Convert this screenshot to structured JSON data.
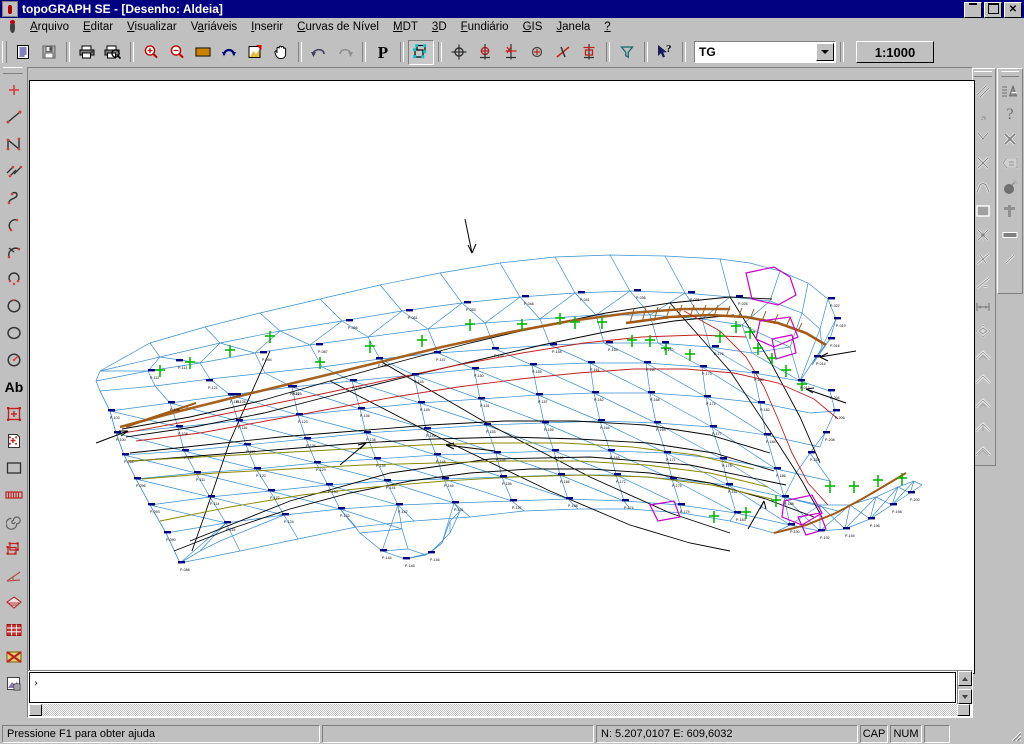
{
  "window": {
    "title": "topoGRAPH SE - [Desenho: Aldeia]",
    "minimize_label": "_",
    "maximize_label": "□",
    "close_label": "✕",
    "app_icon": "topograph-app-icon"
  },
  "menu": {
    "system_icon": "document-pin-icon",
    "items": [
      {
        "label": "Arquivo",
        "accel": "A"
      },
      {
        "label": "Editar",
        "accel": "E"
      },
      {
        "label": "Visualizar",
        "accel": "V"
      },
      {
        "label": "Variáveis",
        "accel": "a"
      },
      {
        "label": "Inserir",
        "accel": "I"
      },
      {
        "label": "Curvas de Nível",
        "accel": "C"
      },
      {
        "label": "MDT",
        "accel": "M"
      },
      {
        "label": "3D",
        "accel": "3"
      },
      {
        "label": "Fundiário",
        "accel": "F"
      },
      {
        "label": "GIS",
        "accel": "G"
      },
      {
        "label": "Janela",
        "accel": "J"
      },
      {
        "label": "?",
        "accel": "?"
      }
    ]
  },
  "toolbar": {
    "buttons": [
      {
        "name": "new-document-button",
        "icon": "document-icon",
        "pressed": false
      },
      {
        "name": "save-button",
        "icon": "floppy-disk-icon",
        "pressed": false
      },
      {
        "name": "print-button",
        "icon": "printer-icon",
        "pressed": false
      },
      {
        "name": "print-preview-button",
        "icon": "print-preview-icon",
        "pressed": false
      },
      {
        "name": "zoom-in-button",
        "icon": "magnifier-plus-icon",
        "pressed": false
      },
      {
        "name": "zoom-out-button",
        "icon": "magnifier-minus-icon",
        "pressed": false
      },
      {
        "name": "zoom-window-button",
        "icon": "zoom-window-icon",
        "pressed": false
      },
      {
        "name": "zoom-previous-button",
        "icon": "undo-arrow-icon",
        "pressed": false
      },
      {
        "name": "zoom-extents-button",
        "icon": "zoom-extents-icon",
        "pressed": false
      },
      {
        "name": "pan-button",
        "icon": "hand-pan-icon",
        "pressed": false
      },
      {
        "name": "undo-button",
        "icon": "undo-icon",
        "pressed": false
      },
      {
        "name": "redo-button",
        "icon": "redo-icon",
        "pressed": false
      },
      {
        "name": "point-text-button",
        "icon": "letter-p-icon",
        "pressed": false
      },
      {
        "name": "select-objects-button",
        "icon": "select-objects-icon",
        "pressed": true
      },
      {
        "name": "snap-node-button",
        "icon": "snap-node-icon",
        "pressed": false
      },
      {
        "name": "snap-point-button",
        "icon": "snap-point-icon",
        "pressed": false
      },
      {
        "name": "snap-quad-button",
        "icon": "snap-quadrant-icon",
        "pressed": false
      },
      {
        "name": "snap-center-button",
        "icon": "snap-center-icon",
        "pressed": false
      },
      {
        "name": "snap-intersect-button",
        "icon": "snap-intersect-icon",
        "pressed": false
      },
      {
        "name": "snap-insert-button",
        "icon": "snap-insert-icon",
        "pressed": false
      },
      {
        "name": "filter-button",
        "icon": "funnel-filter-icon",
        "pressed": false
      },
      {
        "name": "help-pointer-button",
        "icon": "help-arrow-icon",
        "pressed": false
      }
    ],
    "layer_combo": {
      "name": "layer-combo",
      "value": "TG",
      "arrow_icon": "chevron-down-icon"
    },
    "scale_button": {
      "name": "scale-button",
      "value": "1:1000"
    }
  },
  "left_toolbar": {
    "buttons": [
      {
        "name": "tool-point",
        "icon": "point-cross-icon"
      },
      {
        "name": "tool-line",
        "icon": "line-icon"
      },
      {
        "name": "tool-polyline",
        "icon": "polyline-icon"
      },
      {
        "name": "tool-multiline",
        "icon": "multi-segment-icon"
      },
      {
        "name": "tool-spline",
        "icon": "spline-curve-icon"
      },
      {
        "name": "tool-arc",
        "icon": "arc-icon"
      },
      {
        "name": "tool-arc-3point",
        "icon": "arc-3point-icon"
      },
      {
        "name": "tool-arc-center",
        "icon": "arc-center-icon"
      },
      {
        "name": "tool-circle",
        "icon": "circle-icon"
      },
      {
        "name": "tool-ellipse",
        "icon": "ellipse-icon"
      },
      {
        "name": "tool-circle-radius",
        "icon": "circle-radius-icon"
      },
      {
        "name": "tool-text",
        "icon": "text-ab-icon",
        "label": "Ab"
      },
      {
        "name": "tool-block-insert",
        "icon": "block-insert-icon"
      },
      {
        "name": "tool-block-attr",
        "icon": "block-attribute-icon"
      },
      {
        "name": "tool-rectangle",
        "icon": "rectangle-icon"
      },
      {
        "name": "tool-hatch-band",
        "icon": "hatch-band-icon"
      },
      {
        "name": "tool-spiral",
        "icon": "spiral-icon"
      },
      {
        "name": "tool-group",
        "icon": "group-selection-icon"
      },
      {
        "name": "tool-angle",
        "icon": "angle-measure-icon"
      },
      {
        "name": "tool-surface",
        "icon": "surface-icon"
      },
      {
        "name": "tool-grid",
        "icon": "grid-table-icon"
      },
      {
        "name": "tool-crosshatch",
        "icon": "crosshatch-icon"
      },
      {
        "name": "tool-image",
        "icon": "image-insert-icon"
      }
    ]
  },
  "right_toolbar": {
    "column_left": [
      {
        "name": "tool-parallel",
        "icon": "parallel-lines-icon"
      },
      {
        "name": "tool-perpendicular",
        "icon": "perpendicular-icon"
      },
      {
        "name": "tool-divide",
        "icon": "divide-branch-icon"
      },
      {
        "name": "tool-intersection",
        "icon": "x-intersection-icon"
      },
      {
        "name": "tool-fillet",
        "icon": "fillet-arc-icon"
      },
      {
        "name": "tool-fill",
        "icon": "solid-fill-icon"
      },
      {
        "name": "tool-explode",
        "icon": "explode-star-icon"
      },
      {
        "name": "tool-trim",
        "icon": "trim-icon"
      },
      {
        "name": "tool-extend",
        "icon": "extend-icon"
      },
      {
        "name": "tool-dimension",
        "icon": "dimension-arrows-icon"
      },
      {
        "name": "tool-3d-face",
        "icon": "diamond-face-icon"
      },
      {
        "name": "tool-contour-1",
        "icon": "contour-chevron-icon"
      },
      {
        "name": "tool-contour-2",
        "icon": "contour-chevron-icon"
      },
      {
        "name": "tool-contour-3",
        "icon": "contour-chevron-icon"
      },
      {
        "name": "tool-contour-4",
        "icon": "contour-chevron-icon"
      },
      {
        "name": "tool-contour-5",
        "icon": "contour-chevron-icon"
      }
    ],
    "column_right": [
      {
        "name": "tool-list-entity",
        "icon": "list-properties-icon"
      },
      {
        "name": "tool-help",
        "icon": "question-mark-icon",
        "label": "?"
      },
      {
        "name": "tool-erase",
        "icon": "x-erase-icon"
      },
      {
        "name": "tool-properties",
        "icon": "properties-tag-icon"
      },
      {
        "name": "tool-purge",
        "icon": "bomb-purge-icon"
      },
      {
        "name": "tool-move-node",
        "icon": "move-node-icon"
      },
      {
        "name": "tool-rect-solid",
        "icon": "filled-bar-icon"
      },
      {
        "name": "tool-short-line",
        "icon": "short-line-icon"
      }
    ]
  },
  "canvas": {
    "name": "drawing-canvas",
    "document_name": "Aldeia",
    "background": "#ffffff",
    "colors": {
      "tin_edges": "#3a8fd0",
      "breaklines": "#000000",
      "contour_brown": "#a05a14",
      "contour_red": "#c02020",
      "parcel_magenta": "#cc00cc",
      "marker_green": "#00cc00",
      "point_blue": "#0000c0",
      "contour_olive": "#888800"
    },
    "horizontal_ruler": "drawing-ruler-horizontal"
  },
  "command_pane": {
    "name": "command-line-pane",
    "prompt": "›",
    "value": "",
    "scroll_up_icon": "scroll-up-arrow-icon",
    "scroll_down_icon": "scroll-down-arrow-icon",
    "scroll_left_icon": "scroll-left-arrow-icon",
    "scroll_right_icon": "scroll-right-arrow-icon"
  },
  "statusbar": {
    "help_text": "Pressione F1 para obter ajuda",
    "secondary_text": "",
    "coordinates": "N: 5.207,0107 E: 609,6032",
    "caps_indicator": "CAP",
    "num_indicator": "NUM",
    "extra": "",
    "resize_grip": "resize-grip-icon"
  }
}
